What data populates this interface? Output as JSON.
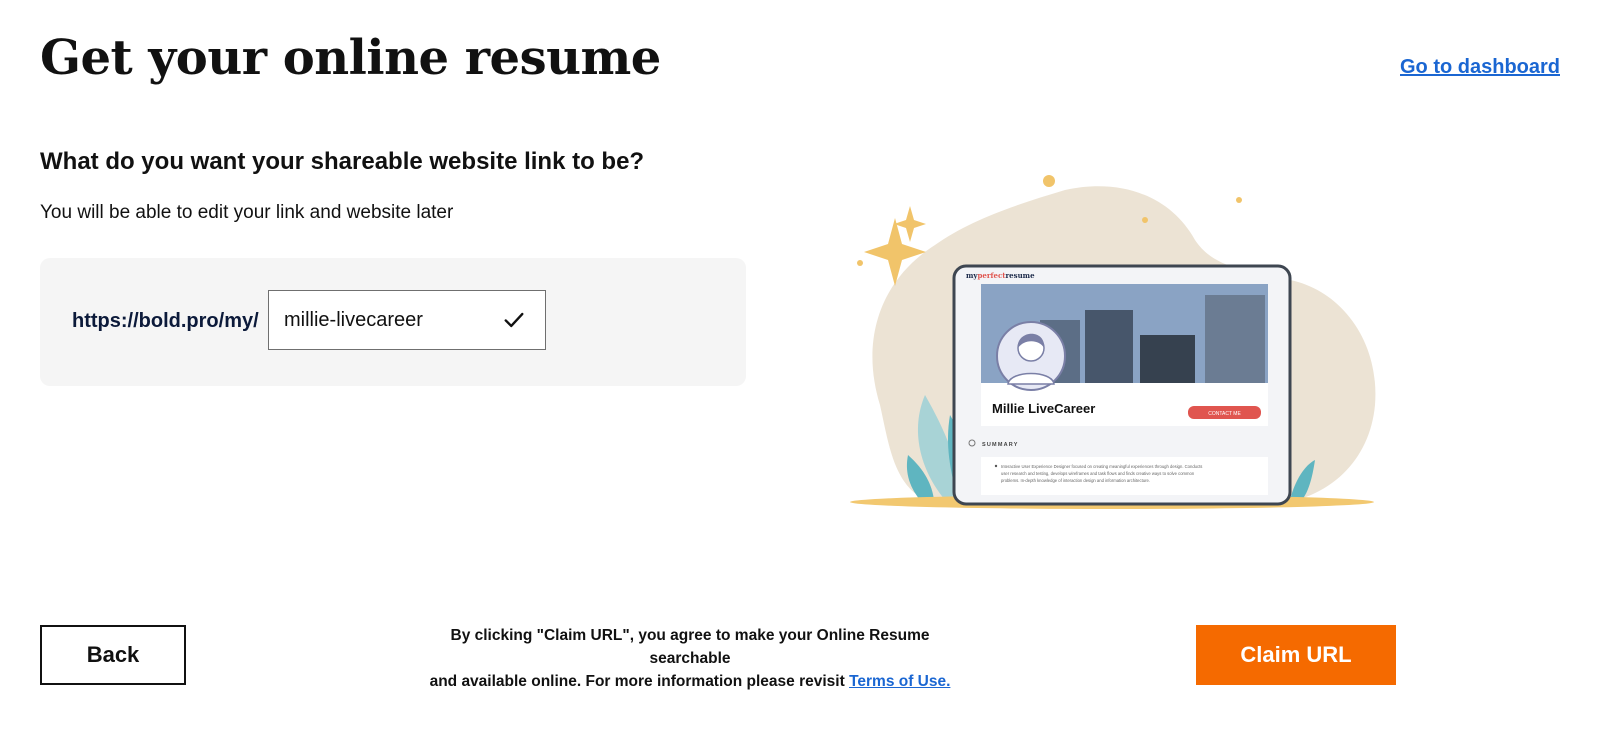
{
  "header": {
    "title": "Get your online resume",
    "dashboard_link": "Go to dashboard"
  },
  "form": {
    "question": "What do you want your shareable website link to be?",
    "helper_text": "You will be able to edit your link and website later",
    "url_prefix": "https://bold.pro/my/",
    "slug_value": "millie-livecareer",
    "valid_icon": "check-icon"
  },
  "preview": {
    "brand_my": "my",
    "brand_perfect": "perfect",
    "brand_resume": "resume",
    "name": "Millie LiveCareer",
    "contact_button": "CONTACT ME",
    "summary_heading": "SUMMARY",
    "summary_line1": "Interactive User Experience Designer focused on creating meaningful experiences through design. Conducts",
    "summary_line2": "user research and testing, develops wireframes and task flows and finds creative ways to solve common",
    "summary_line3": "problems. In-depth knowledge of interaction design and information architecture."
  },
  "footer": {
    "back_label": "Back",
    "legal_line1": "By clicking \"Claim URL\", you agree to make your Online Resume searchable",
    "legal_line2": "and available online. For more information please revisit",
    "terms_link": "Terms of Use.",
    "claim_label": "Claim URL"
  },
  "colors": {
    "accent": "#f56a00",
    "link": "#1a66d2",
    "panel_bg": "#f5f5f5"
  }
}
